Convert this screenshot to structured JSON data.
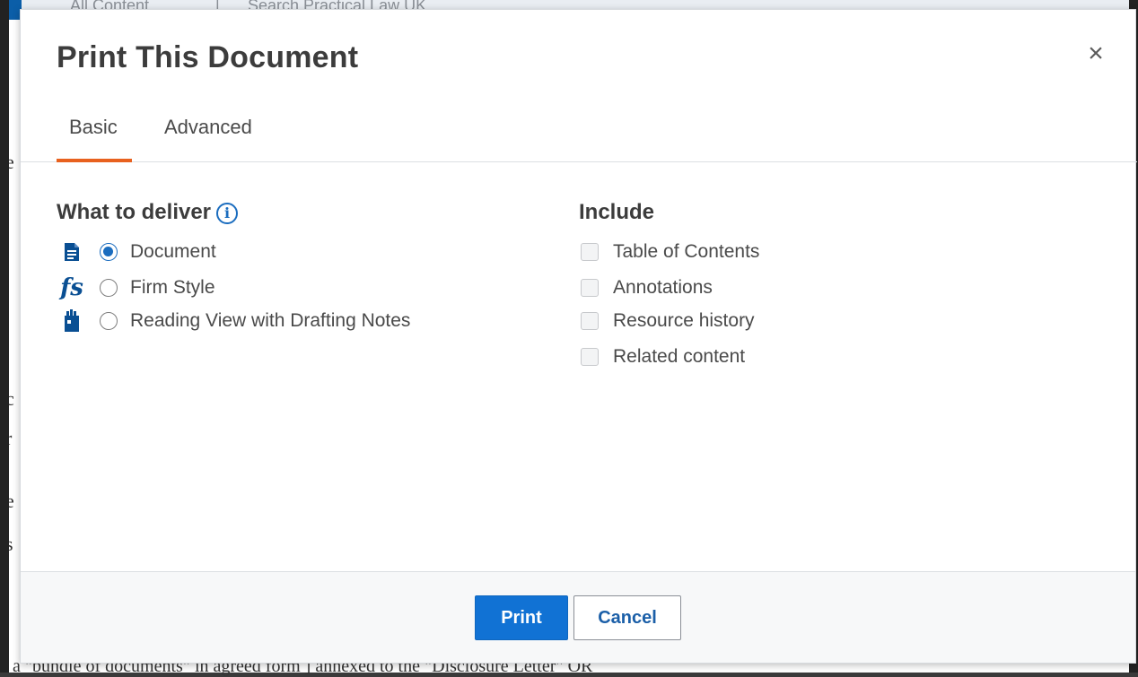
{
  "background": {
    "crumbs": [
      "All Content",
      "|",
      "Search Practical Law UK"
    ],
    "left_fragments": [
      "e",
      "c",
      "r",
      "e",
      "s",
      "s"
    ],
    "bottom_text": "a \"bundle of documents\" in agreed form ] annexed to the \"Disclosure Letter\" OR"
  },
  "dialog": {
    "title": "Print This Document",
    "close_label": "×",
    "tabs": [
      {
        "label": "Basic",
        "active": true
      },
      {
        "label": "Advanced",
        "active": false
      }
    ],
    "deliver": {
      "title": "What to deliver",
      "info_glyph": "i",
      "options": [
        {
          "label": "Document",
          "icon": "document-icon",
          "checked": true
        },
        {
          "label": "Firm Style",
          "icon": "firm-style-icon",
          "icon_text": "fs",
          "checked": false
        },
        {
          "label": "Reading View with Drafting Notes",
          "icon": "drafting-notes-icon",
          "checked": false
        }
      ]
    },
    "include": {
      "title": "Include",
      "options": [
        {
          "label": "Table of Contents",
          "checked": false
        },
        {
          "label": "Annotations",
          "checked": false
        },
        {
          "label": "Resource history",
          "checked": false
        },
        {
          "label": "Related content",
          "checked": false
        }
      ]
    },
    "footer": {
      "print_label": "Print",
      "cancel_label": "Cancel"
    }
  },
  "colors": {
    "accent_blue": "#1172d4",
    "tab_underline": "#e8611e",
    "icon_blue": "#0a4f93"
  }
}
